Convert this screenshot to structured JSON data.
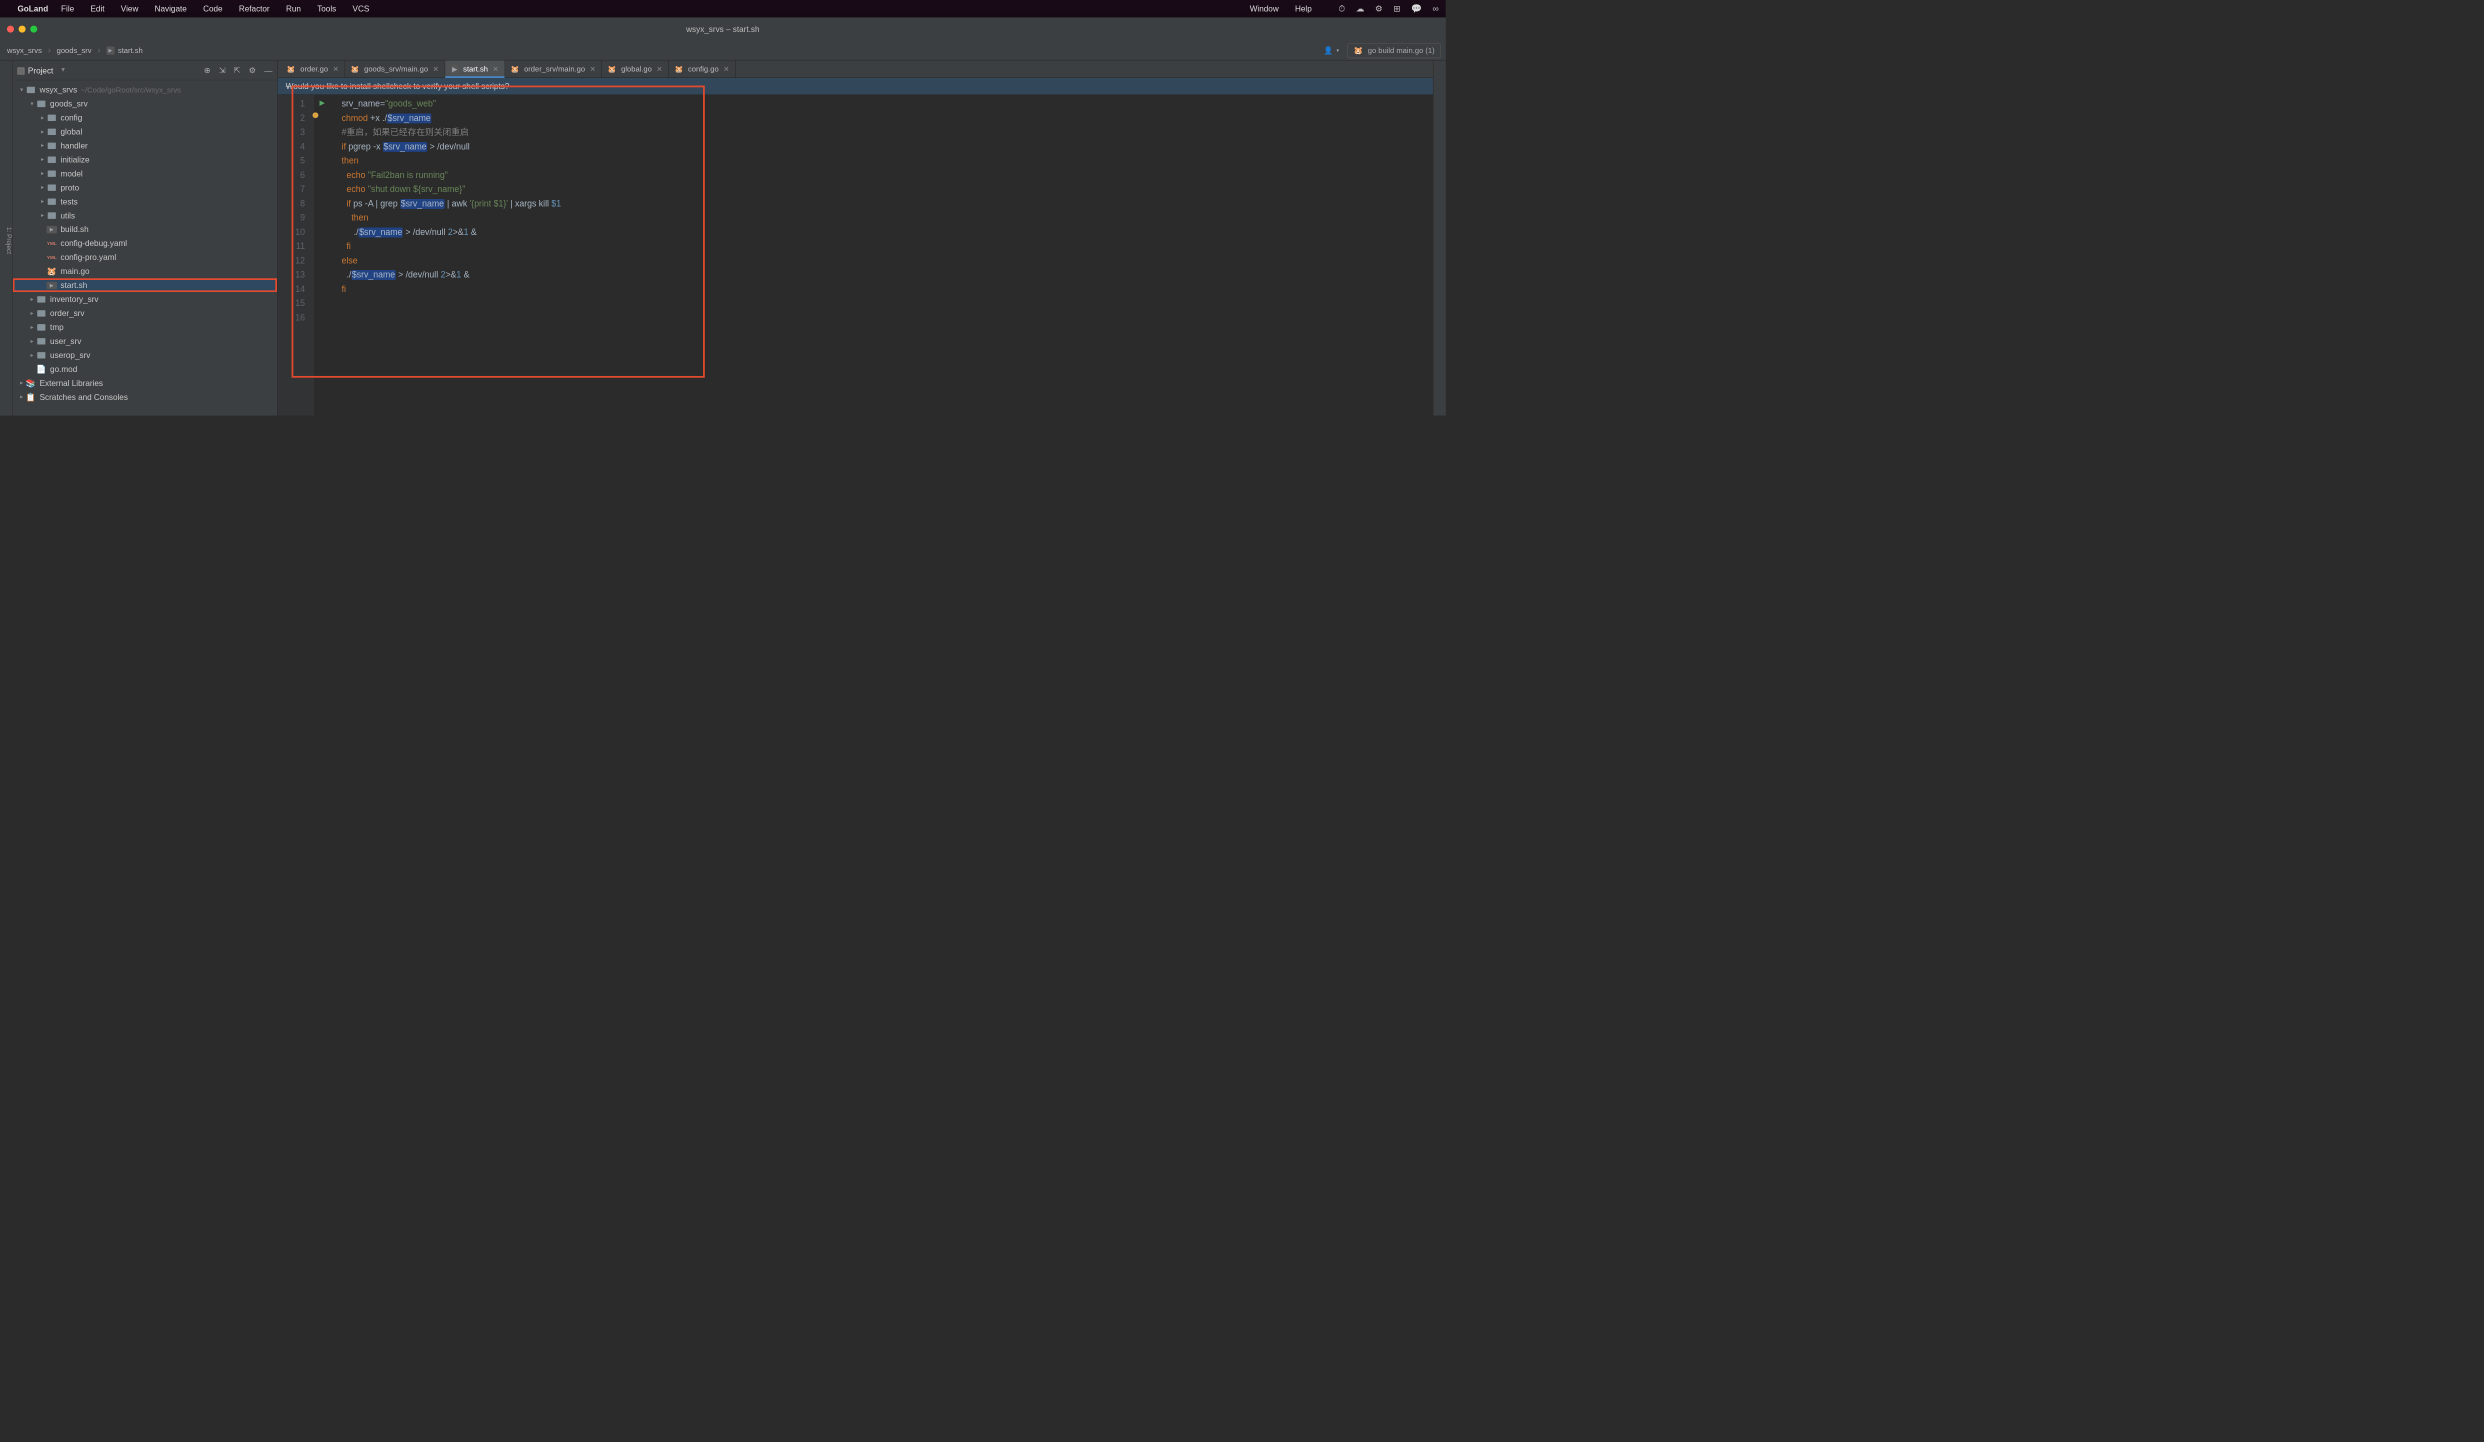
{
  "menubar": {
    "app": "GoLand",
    "items": [
      "File",
      "Edit",
      "View",
      "Navigate",
      "Code",
      "Refactor",
      "Run",
      "Tools",
      "VCS"
    ],
    "right": [
      "Window",
      "Help"
    ]
  },
  "window": {
    "title": "wsyx_srvs – start.sh"
  },
  "breadcrumbs": [
    {
      "label": "wsyx_srvs",
      "icon": "folder"
    },
    {
      "label": "goods_srv",
      "icon": "folder"
    },
    {
      "label": "start.sh",
      "icon": "sh"
    }
  ],
  "runconfig": "go build main.go (1)",
  "projectPanel": {
    "title": "Project"
  },
  "tree": {
    "root": {
      "label": "wsyx_srvs",
      "path": "~/Code/goRoot/src/wsyx_srvs"
    },
    "goods_srv": {
      "label": "goods_srv",
      "dirs": [
        "config",
        "global",
        "handler",
        "initialize",
        "model",
        "proto",
        "tests",
        "utils"
      ],
      "files": [
        {
          "label": "build.sh",
          "type": "sh"
        },
        {
          "label": "config-debug.yaml",
          "type": "yml"
        },
        {
          "label": "config-pro.yaml",
          "type": "yml"
        },
        {
          "label": "main.go",
          "type": "go"
        },
        {
          "label": "start.sh",
          "type": "sh",
          "selected": true
        }
      ]
    },
    "siblings": [
      "inventory_srv",
      "order_srv",
      "tmp",
      "user_srv",
      "userop_srv"
    ],
    "gomod": "go.mod",
    "extlib": "External Libraries",
    "scratch": "Scratches and Consoles"
  },
  "tabs": [
    {
      "label": "order.go",
      "type": "go"
    },
    {
      "label": "goods_srv/main.go",
      "type": "go"
    },
    {
      "label": "start.sh",
      "type": "sh",
      "active": true
    },
    {
      "label": "order_srv/main.go",
      "type": "go"
    },
    {
      "label": "global.go",
      "type": "go"
    },
    {
      "label": "config.go",
      "type": "go"
    }
  ],
  "banner": "Would you like to install shellcheck to verify your shell scripts?",
  "code": {
    "lines": [
      {
        "n": 1,
        "t": [
          [
            "",
            "srv_name"
          ],
          [
            "op",
            "="
          ],
          [
            "str",
            "\"goods_web\""
          ]
        ]
      },
      {
        "n": 2,
        "t": [
          [
            "kw",
            "chmod"
          ],
          [
            "",
            " +x ./"
          ],
          [
            "var",
            "$srv_name"
          ]
        ]
      },
      {
        "n": 3,
        "t": [
          [
            "cmt",
            "#重启，如果已经存在则关闭重启"
          ]
        ]
      },
      {
        "n": 4,
        "t": [
          [
            "kw",
            "if"
          ],
          [
            "",
            " pgrep -x "
          ],
          [
            "var",
            "$srv_name"
          ],
          [
            "",
            " > /dev/null"
          ]
        ]
      },
      {
        "n": 5,
        "t": [
          [
            "kw",
            "then"
          ]
        ]
      },
      {
        "n": 6,
        "t": [
          [
            "",
            "  "
          ],
          [
            "kw",
            "echo"
          ],
          [
            "",
            " "
          ],
          [
            "str",
            "\"Fail2ban is running\""
          ]
        ]
      },
      {
        "n": 7,
        "t": [
          [
            "",
            "  "
          ],
          [
            "kw",
            "echo"
          ],
          [
            "",
            " "
          ],
          [
            "str",
            "\"shut down ${srv_name}\""
          ]
        ]
      },
      {
        "n": 8,
        "t": [
          [
            "",
            "  "
          ],
          [
            "kw",
            "if"
          ],
          [
            "",
            " ps -A | grep "
          ],
          [
            "var",
            "$srv_name"
          ],
          [
            "",
            " | awk "
          ],
          [
            "str",
            "'{print $1}'"
          ],
          [
            "",
            " | xargs kill "
          ],
          [
            "num",
            "$1"
          ]
        ]
      },
      {
        "n": 9,
        "t": [
          [
            "",
            "    "
          ],
          [
            "kw",
            "then"
          ]
        ]
      },
      {
        "n": 10,
        "t": [
          [
            "",
            "     ./"
          ],
          [
            "var",
            "$srv_name"
          ],
          [
            "",
            " > /dev/null "
          ],
          [
            "num",
            "2"
          ],
          [
            "",
            ">&"
          ],
          [
            "num",
            "1"
          ],
          [
            "",
            " &"
          ]
        ]
      },
      {
        "n": 11,
        "t": [
          [
            "",
            "  "
          ],
          [
            "kw",
            "fi"
          ]
        ]
      },
      {
        "n": 12,
        "t": [
          [
            "kw",
            "else"
          ]
        ]
      },
      {
        "n": 13,
        "t": [
          [
            "",
            "  ./"
          ],
          [
            "var",
            "$srv_name"
          ],
          [
            "",
            " > /dev/null "
          ],
          [
            "num",
            "2"
          ],
          [
            "",
            ">&"
          ],
          [
            "num",
            "1"
          ],
          [
            "",
            " &"
          ]
        ]
      },
      {
        "n": 14,
        "t": [
          [
            "kw",
            "fi"
          ]
        ]
      },
      {
        "n": 15,
        "t": []
      },
      {
        "n": 16,
        "t": []
      }
    ]
  }
}
